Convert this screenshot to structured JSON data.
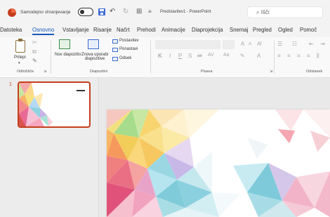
{
  "titlebar": {
    "autosave_label": "Samodejno shranjevanje",
    "document_title": "Predstavitev1 - PowerPoint",
    "search_text": "Išči"
  },
  "menu": {
    "items": [
      "Datoteka",
      "Osnovno",
      "Vstavljanje",
      "Risanje",
      "Načrt",
      "Prehodi",
      "Animacije",
      "Diaprojekcija",
      "Snemaj",
      "Pregled",
      "Ogled",
      "Pomoč"
    ],
    "active": "Osnovno"
  },
  "ribbon": {
    "clipboard": {
      "paste": "Prilepi",
      "group": "Odložišče"
    },
    "slides": {
      "new_slide": "Nov diapozitiv",
      "reuse_slides": "Znova uporabi diapozitive",
      "layout": "Postavitev",
      "reset": "Ponastavi",
      "section": "Odsek",
      "group": "Diapozitivi"
    },
    "font": {
      "group": "Pisava",
      "size_up": "A",
      "size_down": "A"
    },
    "paragraph": {
      "group": "Odstavek"
    }
  },
  "slides_pane": {
    "slide_number": "1"
  },
  "colors": {
    "accent": "#c43e1c",
    "active_tab": "#185abd",
    "bg": "#f3f3f3"
  }
}
